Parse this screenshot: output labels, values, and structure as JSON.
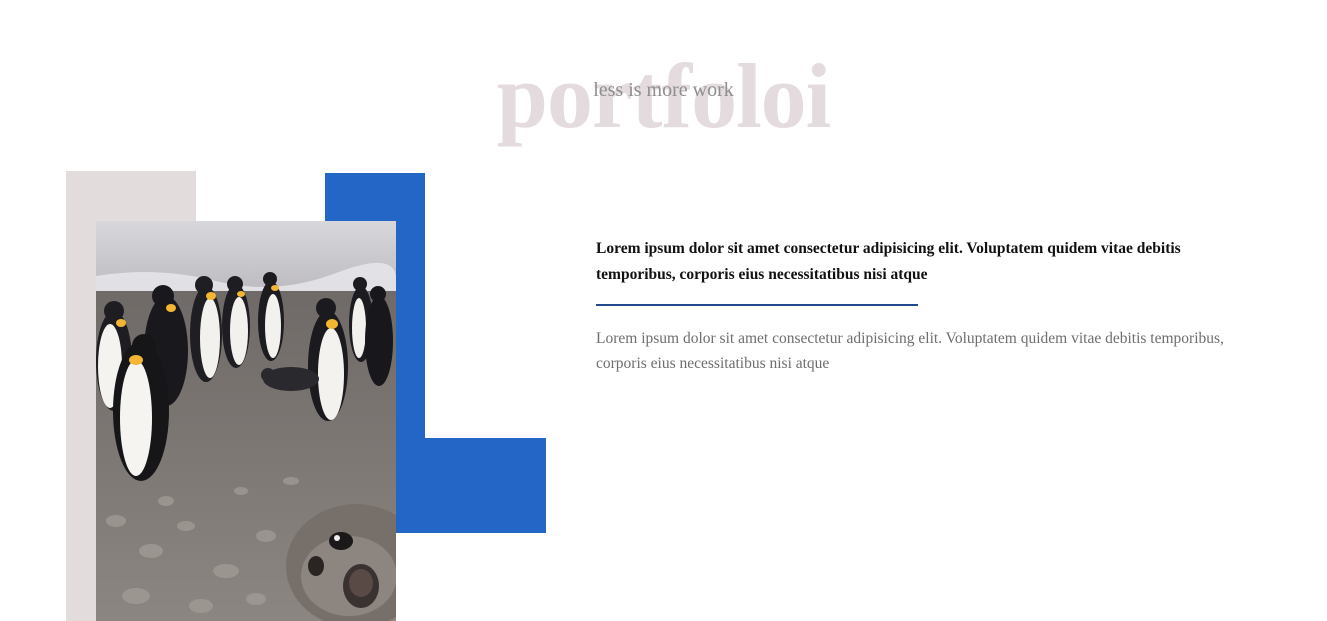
{
  "header": {
    "title": "portfoloi",
    "subtitle": "less is more work"
  },
  "main": {
    "heading": "Lorem ipsum dolor sit amet consectetur adipisicing elit. Voluptatem quidem vitae debitis temporibus, corporis eius necessitatibus nisi atque",
    "body": "Lorem ipsum dolor sit amet consectetur adipisicing elit. Voluptatem quidem vitae debitis temporibus, corporis eius necessitatibus nisi atque"
  },
  "colors": {
    "title": "#e3dbdd",
    "accent_blue": "#2466c6",
    "divider": "#234a8c",
    "pink_block": "#e2dcdd"
  },
  "image": {
    "subject": "penguins-and-seal-photo"
  }
}
